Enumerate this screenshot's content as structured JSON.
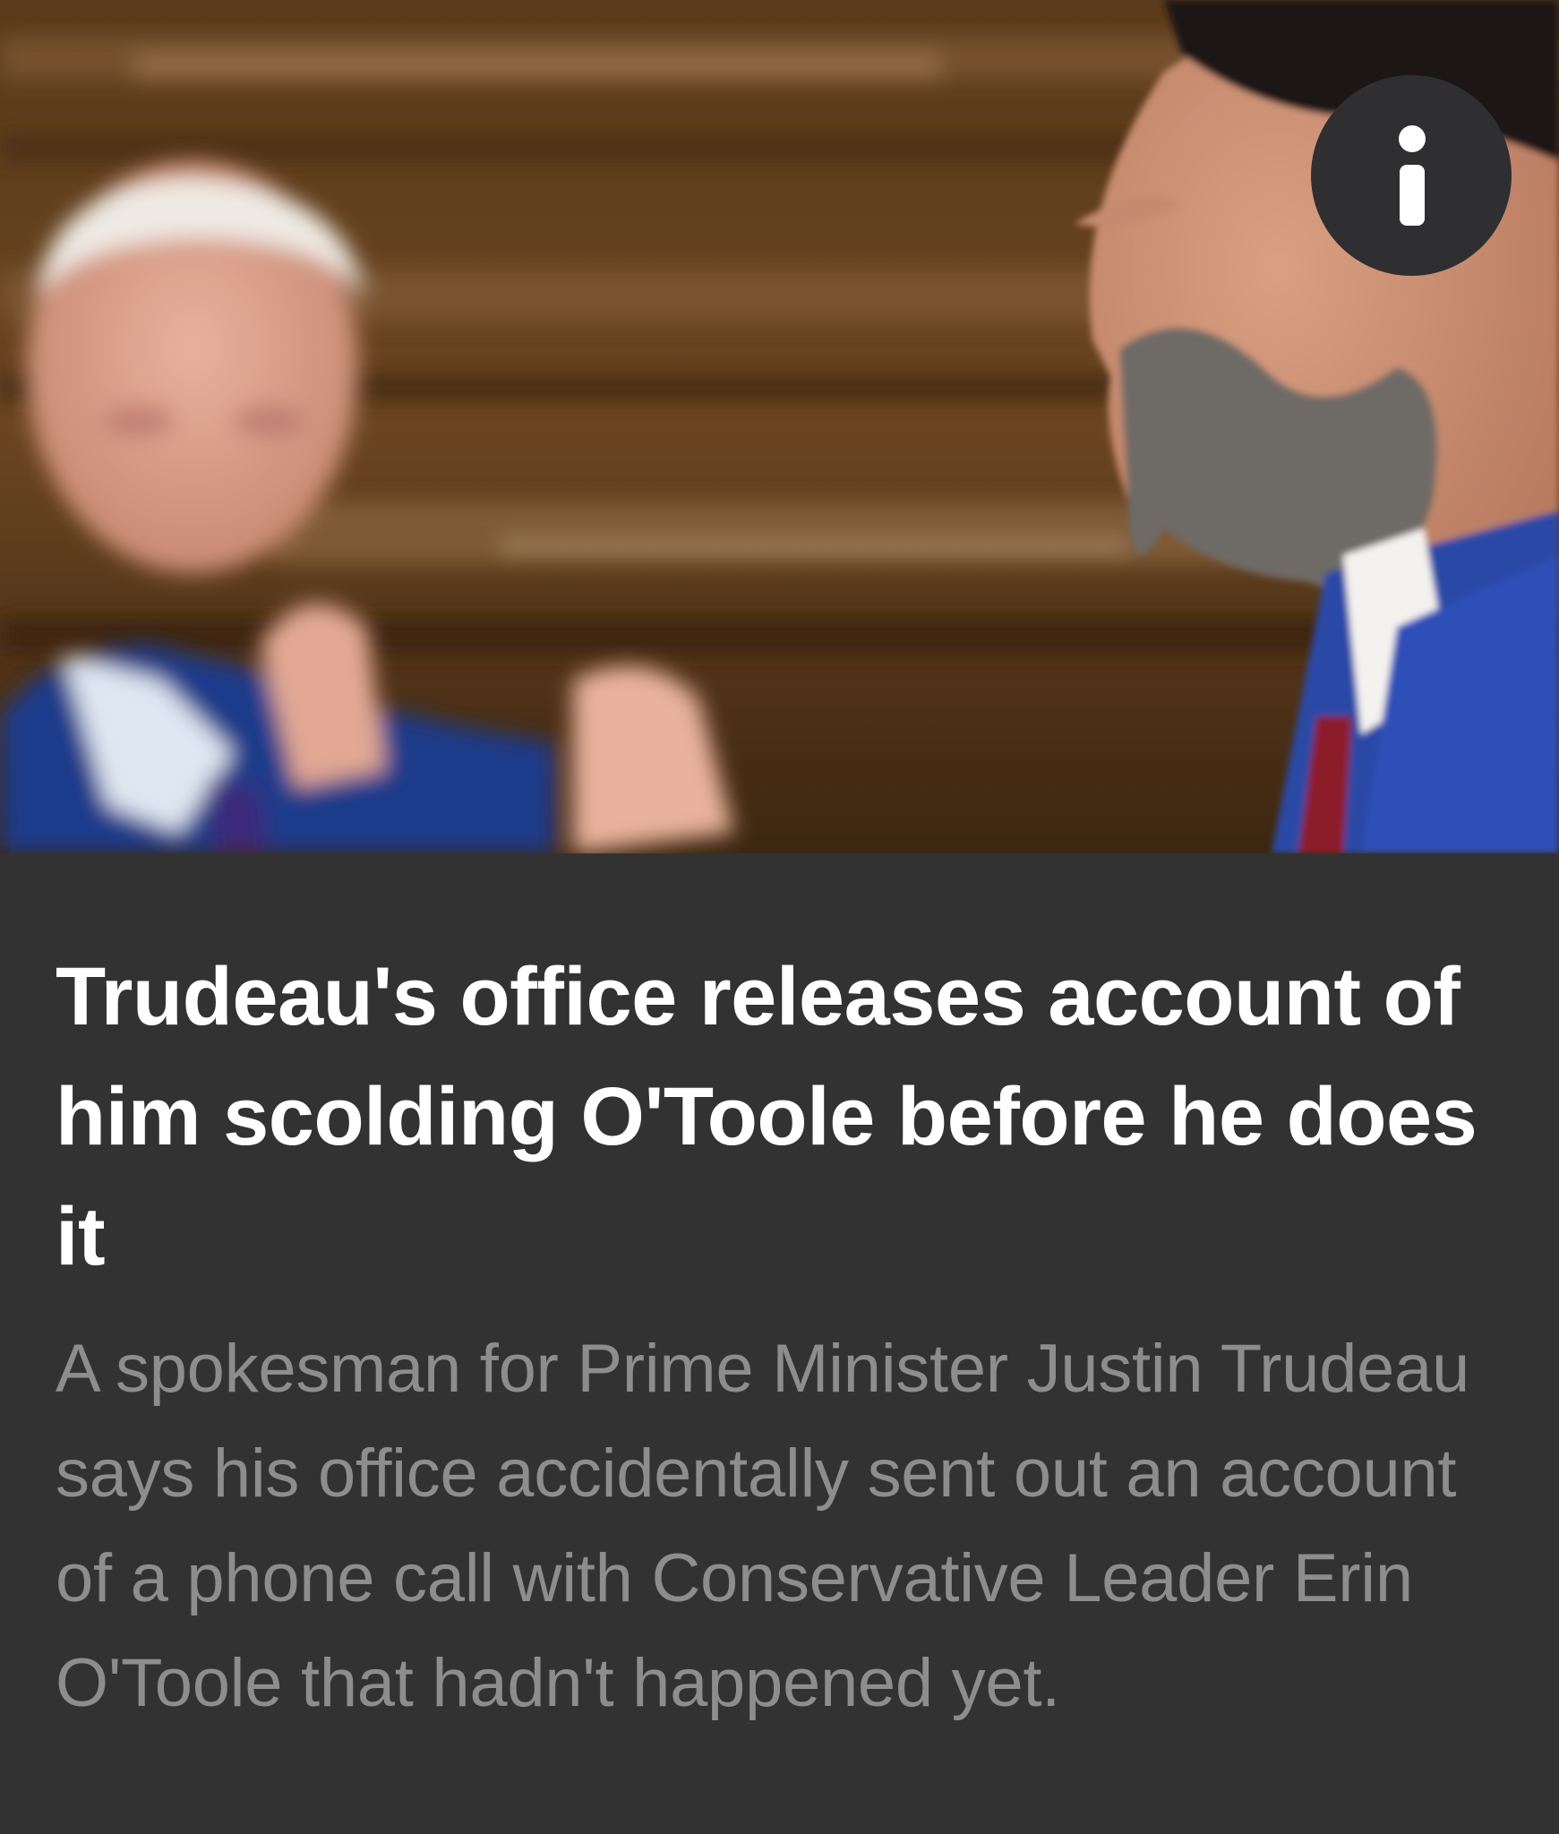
{
  "article": {
    "headline": "Trudeau's office releases account of him scolding O'Toole before he does it",
    "summary": "A spokesman for Prime Minister Justin Trudeau says his office accidentally sent out an account of a phone call with Conservative Leader Erin O'Toole that hadn't happened yet."
  },
  "icons": {
    "info": "info-icon"
  },
  "colors": {
    "card_background": "#323232",
    "headline": "#ffffff",
    "summary": "#8d8d8d",
    "info_button": "#2f2f31"
  }
}
